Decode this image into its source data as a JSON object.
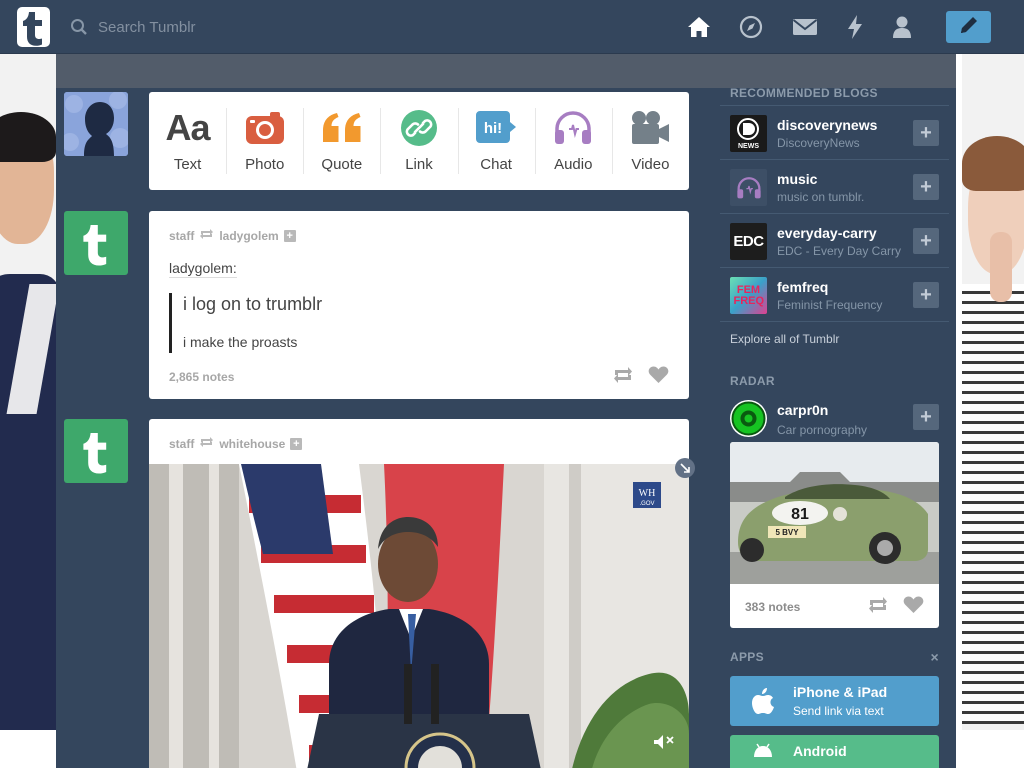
{
  "header": {
    "search_placeholder": "Search Tumblr",
    "nav": [
      "home-icon",
      "explore-icon",
      "inbox-icon",
      "activity-icon",
      "account-icon"
    ],
    "compose": "pencil-icon"
  },
  "post_types": [
    {
      "label": "Text",
      "icon": "text-icon",
      "color": "#444444"
    },
    {
      "label": "Photo",
      "icon": "camera-icon",
      "color": "#d95e40"
    },
    {
      "label": "Quote",
      "icon": "quote-icon",
      "color": "#f2992e"
    },
    {
      "label": "Link",
      "icon": "link-icon",
      "color": "#56bc8a"
    },
    {
      "label": "Chat",
      "icon": "chat-icon",
      "color": "#529ecc"
    },
    {
      "label": "Audio",
      "icon": "headphones-icon",
      "color": "#a77dc2"
    },
    {
      "label": "Video",
      "icon": "video-camera-icon",
      "color": "#748089"
    }
  ],
  "posts": [
    {
      "reblogger": "staff",
      "source": "ladygolem",
      "source_label": "ladygolem:",
      "quote_line1": "i log on to trumblr",
      "quote_line2": "i make the proasts",
      "notes": "2,865 notes"
    },
    {
      "reblogger": "staff",
      "source": "whitehouse"
    }
  ],
  "sidebar": {
    "recommended_title": "RECOMMENDED BLOGS",
    "blogs": [
      {
        "name": "discoverynews",
        "desc": "DiscoveryNews",
        "avatar_text": "NEWS"
      },
      {
        "name": "music",
        "desc": "music on tumblr.",
        "avatar_text": ""
      },
      {
        "name": "everyday-carry",
        "desc": "EDC - Every Day Carry",
        "avatar_text": "EDC"
      },
      {
        "name": "femfreq",
        "desc": "Feminist Frequency",
        "avatar_text": "FEM FREQ"
      }
    ],
    "explore": "Explore all of Tumblr",
    "radar_title": "RADAR",
    "radar": {
      "name": "carpr0n",
      "desc": "Car pornography",
      "notes": "383 notes",
      "plate": "5 BVY",
      "number": "81"
    },
    "apps_title": "APPS",
    "apps_close": "×",
    "apps": [
      {
        "name": "iPhone & iPad",
        "sub": "Send link via text"
      },
      {
        "name": "Android",
        "sub": ""
      }
    ]
  },
  "colors": {
    "navy": "#34465d",
    "blue": "#529ecc",
    "green": "#56bc8a"
  }
}
